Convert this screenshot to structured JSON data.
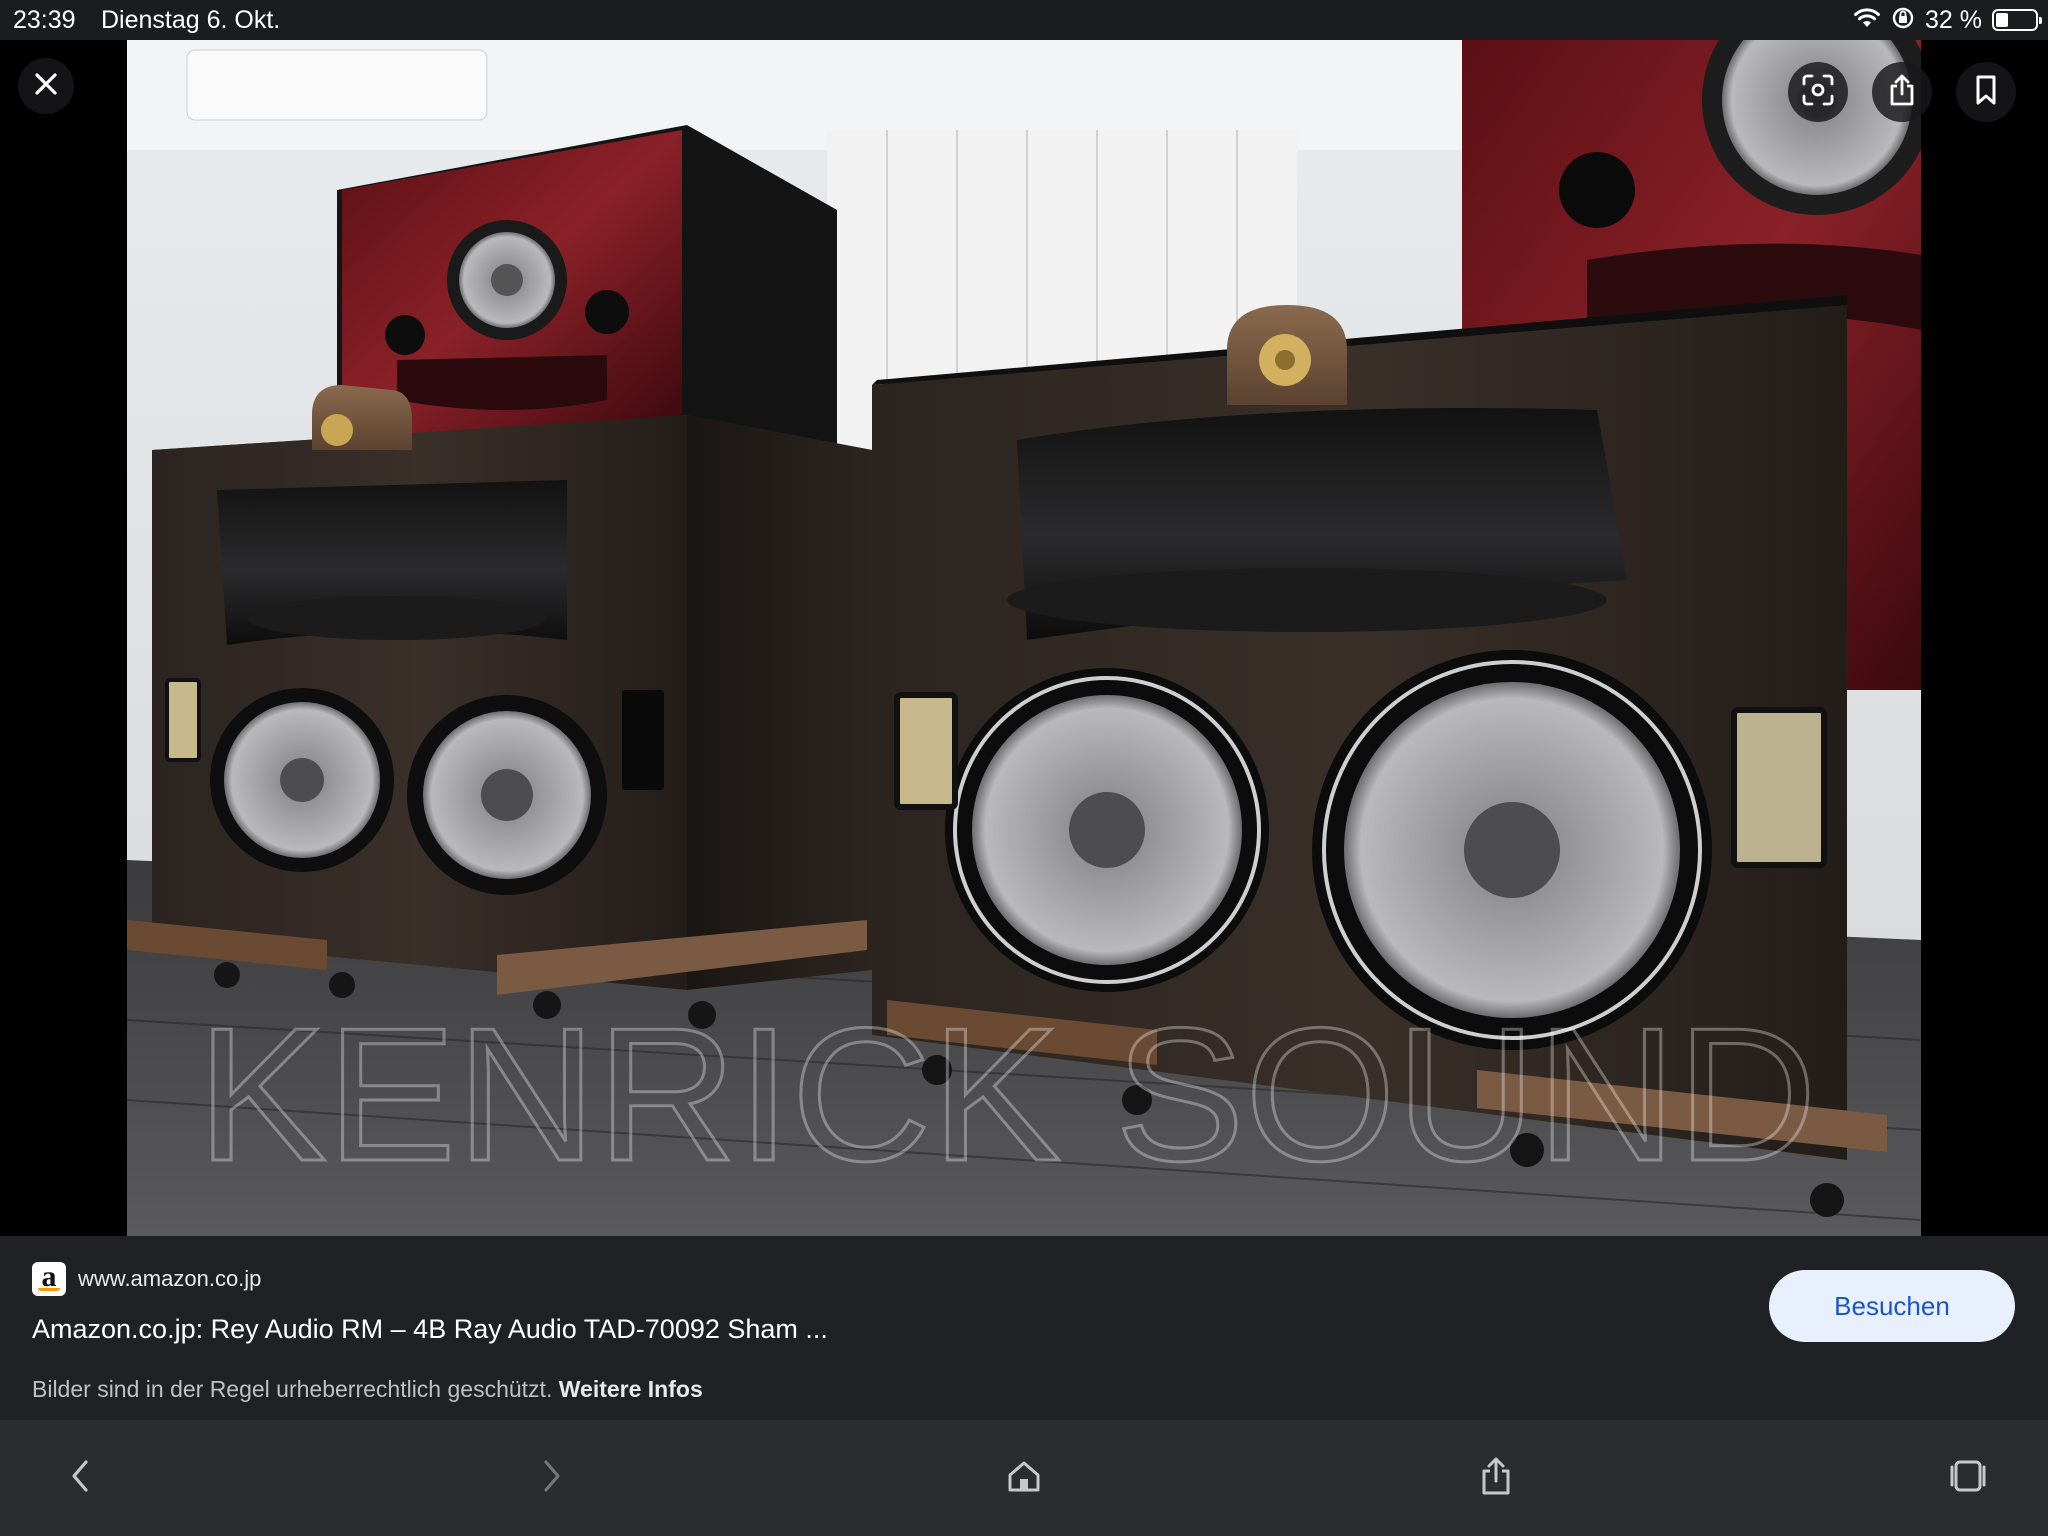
{
  "status_bar": {
    "time": "23:39",
    "date": "Dienstag 6. Okt.",
    "battery_text": "32 %",
    "battery_level": 0.32,
    "icons": [
      "wifi-icon",
      "orientation-lock-icon",
      "battery-icon"
    ]
  },
  "viewer": {
    "watermark": "KENRICK SOUND",
    "overlay_buttons": [
      "close-icon",
      "lens-search-icon",
      "share-icon",
      "bookmark-icon"
    ]
  },
  "result": {
    "favicon_letter": "a",
    "domain": "www.amazon.co.jp",
    "title": "Amazon.co.jp: Rey Audio RM – 4B Ray Audio TAD-70092 Sham ...",
    "visit_label": "Besuchen",
    "copyright_text": "Bilder sind in der Regel urheberrechtlich geschützt. ",
    "more_info": "Weitere Infos"
  },
  "toolbar": {
    "icons": [
      "back-icon",
      "forward-icon",
      "home-icon",
      "share-icon",
      "tabs-icon"
    ]
  },
  "colors": {
    "panel_bg": "#202124",
    "toolbar_bg": "#2b2c2f",
    "visit_bg": "#e8f0fe",
    "visit_text": "#1a56c8"
  }
}
